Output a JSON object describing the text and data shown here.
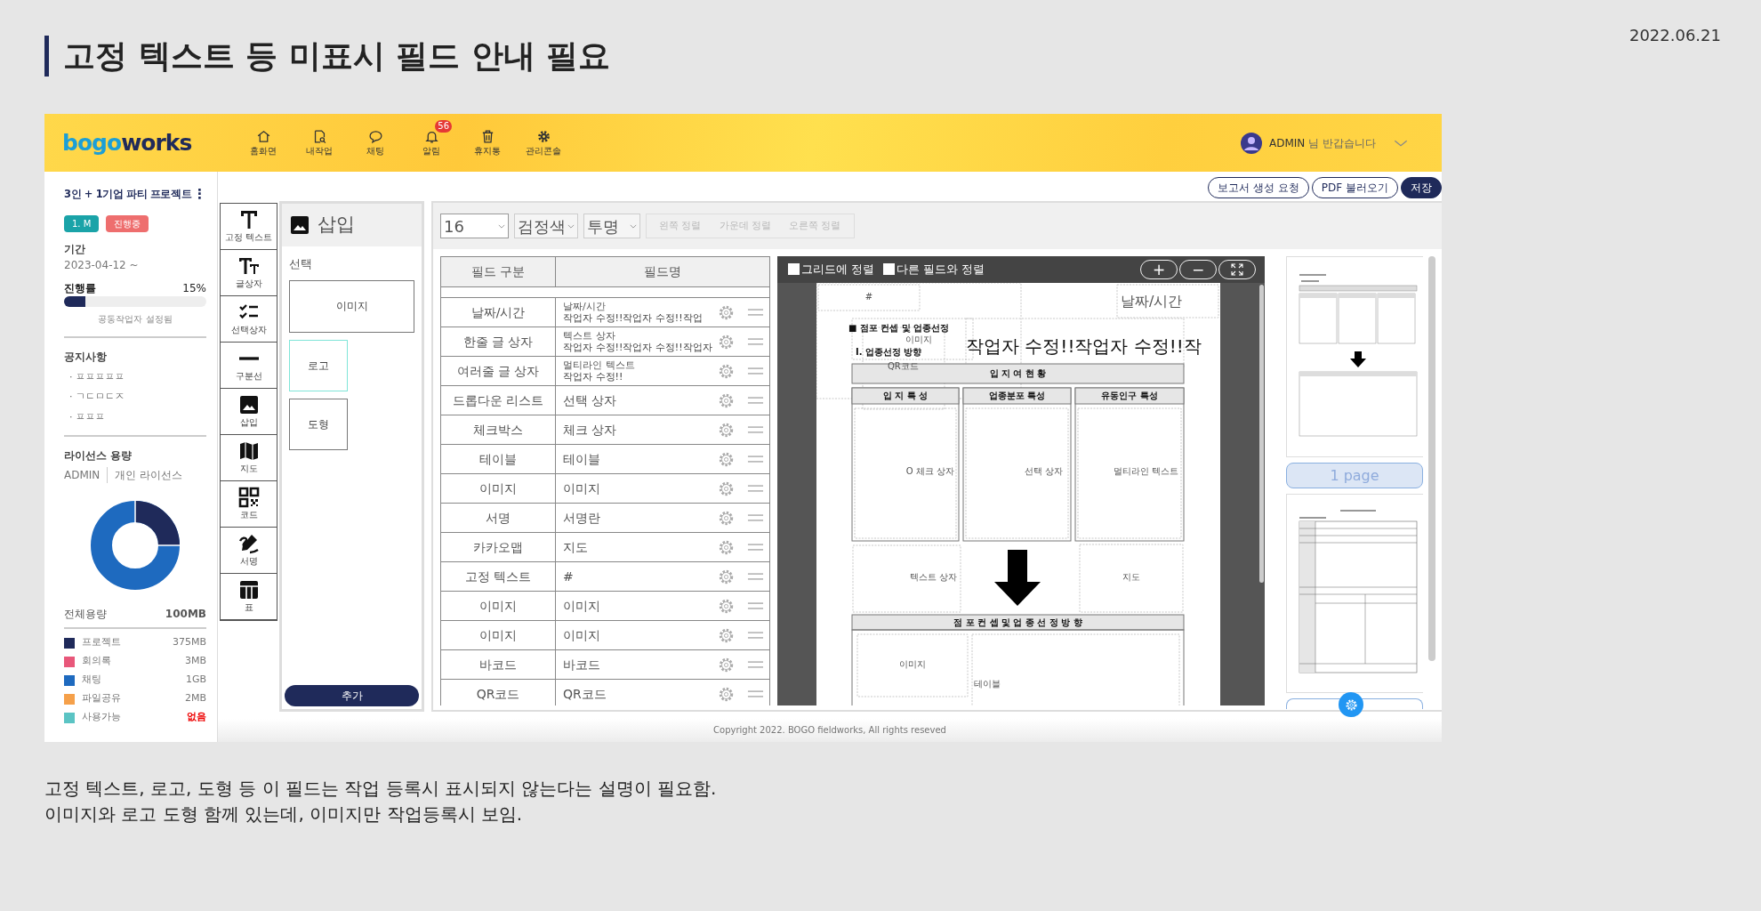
{
  "slide": {
    "title": "고정 텍스트 등 미표시 필드 안내 필요",
    "date": "2022.06.21",
    "notes": [
      "고정 텍스트, 로고, 도형 등 이 필드는 작업 등록시 표시되지 않는다는 설명이 필요함.",
      "이미지와 로고 도형 함께 있는데, 이미지만 작업등록시 보임."
    ]
  },
  "header": {
    "logo": {
      "part_1": "bogo",
      "part_2": "works"
    },
    "nav": [
      {
        "label": "홈화면"
      },
      {
        "label": "내작업"
      },
      {
        "label": "채팅"
      },
      {
        "label": "알림",
        "badge": "56"
      },
      {
        "label": "휴지통"
      },
      {
        "label": "관리콘솔"
      }
    ],
    "user": {
      "name": "ADMIN",
      "greeting": "님 반갑습니다"
    }
  },
  "actions": [
    {
      "label": "보고서 생성 요청",
      "kind": "outline"
    },
    {
      "label": "PDF 불러오기",
      "kind": "outline"
    },
    {
      "label": "저장",
      "kind": "primary"
    }
  ],
  "project": {
    "title": "3인 + 1기업 파티 프로젝트",
    "menu": "⋮",
    "tags": [
      {
        "label": "1. M",
        "color": "#1aa3a8"
      },
      {
        "label": "진행중",
        "color": "#ee6e6e"
      }
    ],
    "period_label": "기간",
    "period": "2023-04-12 ~",
    "progress_label": "진행률",
    "progress_reading": "15%",
    "level": 0.15,
    "collaborator_note": "공동작업자 설정됨"
  },
  "notices": {
    "title": "공지사항",
    "items": [
      "· ㅍㅍㅍㅍㅍ",
      "· ㄱㄷㅁㄷㅈ",
      "· ㅍㅍㅍ"
    ]
  },
  "license": {
    "title": "라이선스 용량",
    "user": "ADMIN",
    "type": "개인 라이선스",
    "total_label": "전체용량",
    "total": "100MB",
    "items": [
      {
        "label": "프로젝트",
        "value": "375MB",
        "color": "#1f2a5a",
        "alert": false
      },
      {
        "label": "회의록",
        "value": "3MB",
        "color": "#e8577a",
        "alert": false
      },
      {
        "label": "채팅",
        "value": "1GB",
        "color": "#1e6abf",
        "alert": false
      },
      {
        "label": "파일공유",
        "value": "2MB",
        "color": "#f5a04a",
        "alert": false
      },
      {
        "label": "사용가능",
        "value": "없음",
        "color": "#5bc4c4",
        "alert": true
      }
    ]
  },
  "tools": [
    {
      "label": "고정 텍스트"
    },
    {
      "label": "글상자"
    },
    {
      "label": "선택상자"
    },
    {
      "label": "구분선"
    },
    {
      "label": "삽입"
    },
    {
      "label": "지도"
    },
    {
      "label": "코드"
    },
    {
      "label": "서명"
    },
    {
      "label": "표"
    }
  ],
  "insert_panel": {
    "title": "삽입",
    "section": "선택",
    "options": [
      {
        "label": "이미지",
        "selected": false
      },
      {
        "label": "로고",
        "selected": true
      },
      {
        "label": "도형",
        "selected": false
      }
    ],
    "add_button": "추가"
  },
  "format_bar": {
    "size": "16",
    "ink": "검정색",
    "background": "투명",
    "align": [
      "왼쪽 정렬",
      "가운데 정렬",
      "오른쪽 정렬"
    ]
  },
  "field_table": {
    "columns": [
      "필드 구분",
      "필드명"
    ],
    "rows": [
      {
        "type": "날짜/시간",
        "name": "날짜/시간",
        "overlay": "작업자 수정!!작업자 수정!!작업"
      },
      {
        "type": "한줄 글 상자",
        "name": "텍스트 상자",
        "overlay": "작업자 수정!!작업자 수정!!작업자"
      },
      {
        "type": "여러줄 글 상자",
        "name": "멀티라인 텍스트",
        "overlay": "작업자 수정!!"
      },
      {
        "type": "드롭다운 리스트",
        "name": "선택 상자"
      },
      {
        "type": "체크박스",
        "name": "체크 상자"
      },
      {
        "type": "테이블",
        "name": "테이블"
      },
      {
        "type": "이미지",
        "name": "이미지"
      },
      {
        "type": "서명",
        "name": "서명란"
      },
      {
        "type": "카카오맵",
        "name": "지도"
      },
      {
        "type": "고정 텍스트",
        "name": "#"
      },
      {
        "type": "이미지",
        "name": "이미지"
      },
      {
        "type": "이미지",
        "name": "이미지"
      },
      {
        "type": "바코드",
        "name": "바코드"
      },
      {
        "type": "QR코드",
        "name": "QR코드"
      }
    ]
  },
  "canvas": {
    "options": [
      {
        "label": "그리드에 정렬",
        "checked": false
      },
      {
        "label": "다른 필드와 정렬",
        "checked": false
      }
    ],
    "zoom_in": "+",
    "zoom_out": "−",
    "fields": [
      {
        "text": "#",
        "kind": "field"
      },
      {
        "text": "날짜/시간",
        "kind": "field"
      },
      {
        "text": "■ 점포 컨셉 및 업종선정",
        "kind": "print"
      },
      {
        "text": "이미지",
        "kind": "field"
      },
      {
        "text": "I. 업종선정 방향",
        "kind": "print"
      },
      {
        "text": "QR코드",
        "kind": "field"
      },
      {
        "text": "작업자 수정!!작업자 수정!!작",
        "kind": "big"
      },
      {
        "text": "입 지 여 현 황",
        "kind": "print"
      },
      {
        "text": "입 지 특 성",
        "kind": "print"
      },
      {
        "text": "업종분포 특성",
        "kind": "print"
      },
      {
        "text": "유동인구 특성",
        "kind": "print"
      },
      {
        "text": "O 체크 상자",
        "kind": "field"
      },
      {
        "text": "선택 상자",
        "kind": "field"
      },
      {
        "text": "멀티라인 텍스트",
        "kind": "field"
      },
      {
        "text": "텍스트 상자",
        "kind": "field"
      },
      {
        "text": "지도",
        "kind": "field"
      },
      {
        "text": "점 포 컨 셉 및 업 종 선 정 방 향",
        "kind": "print"
      },
      {
        "text": "이미지",
        "kind": "field"
      },
      {
        "text": "테이블",
        "kind": "field"
      }
    ]
  },
  "pages": [
    {
      "label": "1 page",
      "selected": true
    }
  ],
  "footer": "Copyright 2022. BOGO fieldworks, All rights reseved"
}
